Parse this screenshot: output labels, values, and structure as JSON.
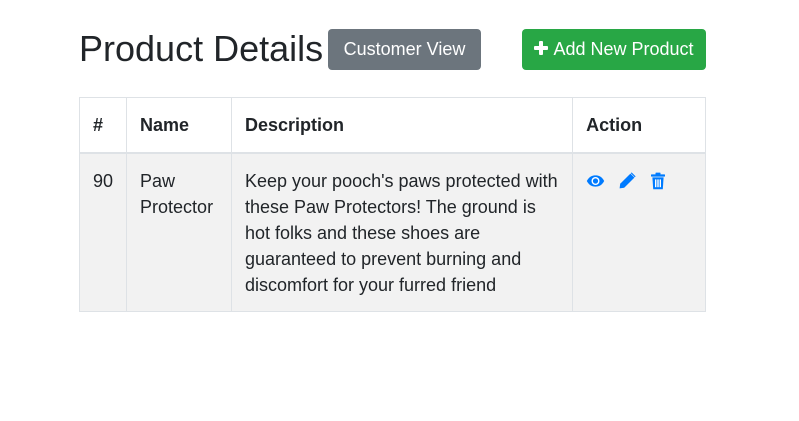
{
  "header": {
    "title": "Product Details",
    "customer_view_label": "Customer View",
    "add_product_label": "Add New Product",
    "add_icon": "plus-icon"
  },
  "table": {
    "columns": [
      "#",
      "Name",
      "Description",
      "Action"
    ],
    "rows": [
      {
        "id": "90",
        "name": "Paw Protector",
        "description": "Keep your pooch's paws protected with these Paw Protectors! The ground is hot folks and these shoes are guaranteed to prevent burning and discomfort for your furred friend",
        "actions": [
          "eye-icon",
          "pencil-icon",
          "trash-icon"
        ]
      }
    ]
  },
  "colors": {
    "secondary_button": "#6c757d",
    "success_button": "#28a745",
    "action_icon": "#007bff",
    "row_background": "#f2f2f2",
    "border": "#dee2e6"
  }
}
